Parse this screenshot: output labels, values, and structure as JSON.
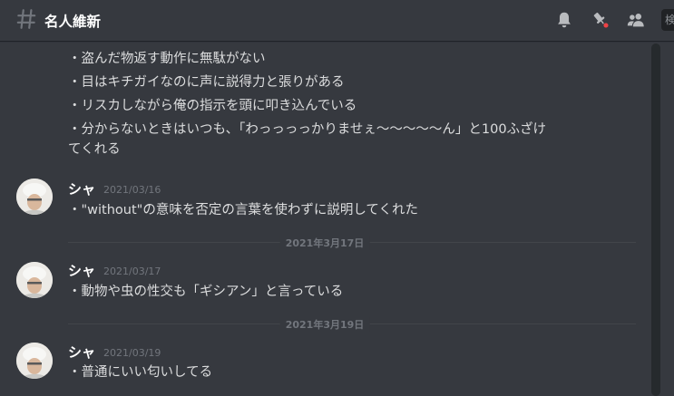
{
  "channel": {
    "name": "名人維新"
  },
  "header": {
    "icons": [
      "hash-icon",
      "bell-icon",
      "pin-icon",
      "members-icon"
    ],
    "search_fragment": "検"
  },
  "continued_message": {
    "lines": [
      "・盗んだ物返す動作に無駄がない",
      "・目はキチガイなのに声に説得力と張りがある",
      "・リスカしながら俺の指示を頭に叩き込んでいる",
      "・分からないときはいつも、「わっっっっかりませぇ〜〜〜〜〜ん」と100ふざけ",
      "てくれる"
    ]
  },
  "messages": [
    {
      "author": "シャ",
      "timestamp": "2021/03/16",
      "text": "・\"without\"の意味を否定の言葉を使わずに説明してくれた"
    },
    {
      "author": "シャ",
      "timestamp": "2021/03/17",
      "text": "・動物や虫の性交も「ギシアン」と言っている"
    },
    {
      "author": "シャ",
      "timestamp": "2021/03/19",
      "text": "・普通にいい匂いしてる"
    }
  ],
  "dividers": [
    {
      "label": "2021年3月17日"
    },
    {
      "label": "2021年3月19日"
    }
  ],
  "colors": {
    "background": "#36393f",
    "text": "#dcddde",
    "muted": "#72767d",
    "notification_dot": "#ed4245"
  }
}
